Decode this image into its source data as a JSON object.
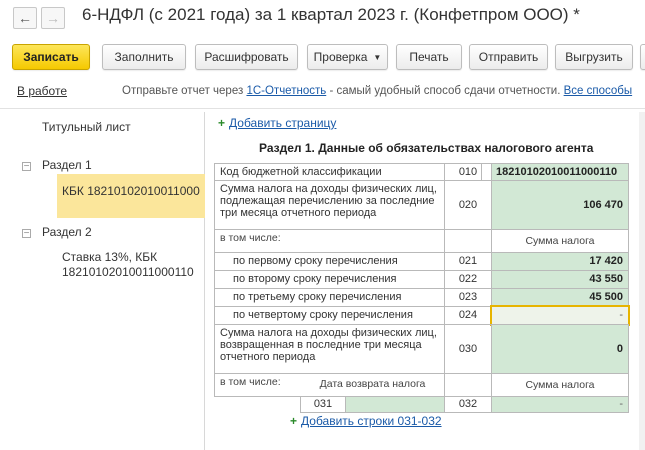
{
  "window": {
    "title": "6-НДФЛ (с 2021 года) за 1 квартал 2023 г. (Конфетпром ООО) *",
    "nav_back": "←",
    "nav_forward": "→"
  },
  "toolbar": {
    "save": "Записать",
    "fill": "Заполнить",
    "decode": "Расшифровать",
    "check": "Проверка",
    "print": "Печать",
    "send": "Отправить",
    "upload": "Выгрузить"
  },
  "status": {
    "state": "В работе",
    "message_prefix": "Отправьте отчет через",
    "message_link": "1С-Отчетность",
    "message_suffix": "- самый удобный способ сдачи отчетности.",
    "all_methods": "Все способы"
  },
  "tree": {
    "title_page": "Титульный лист",
    "section1": "Раздел 1",
    "section1_kbk": "КБК 18210102010011000",
    "section2": "Раздел 2",
    "section2_rate_line1": "Ставка 13%, КБК",
    "section2_rate_line2": "18210102010011000110"
  },
  "form": {
    "add_page": "Добавить страницу",
    "section_title": "Раздел 1. Данные об обязательствах налогового агента",
    "kbk_label": "Код бюджетной классификации",
    "kbk_code": "010",
    "kbk_value": "18210102010011000110",
    "row020_line1": "Сумма налога на доходы физических лиц,",
    "row020_line2": "подлежащая перечислению за последние",
    "row020_line3": "три месяца отчетного периода",
    "row020_code": "020",
    "row020_value": "106 470",
    "including": "в том числе:",
    "tax_sum_header": "Сумма налога",
    "row021_label": "по первому сроку перечисления",
    "row021_code": "021",
    "row021_value": "17 420",
    "row022_label": "по второму сроку перечисления",
    "row022_code": "022",
    "row022_value": "43 550",
    "row023_label": "по третьему сроку перечисления",
    "row023_code": "023",
    "row023_value": "45 500",
    "row024_label": "по четвертому сроку перечисления",
    "row024_code": "024",
    "row024_value": "-",
    "row030_line1": "Сумма налога на доходы физических лиц,",
    "row030_line2": "возвращенная в последние три месяца",
    "row030_line3": "отчетного периода",
    "row030_code": "030",
    "row030_value": "0",
    "including2": "в том числе:",
    "return_date_header": "Дата возврата налога",
    "tax_sum_header2": "Сумма налога",
    "row031_code": "031",
    "row032_code": "032",
    "row032_value": "-",
    "add_rows": "Добавить строки 031-032"
  }
}
